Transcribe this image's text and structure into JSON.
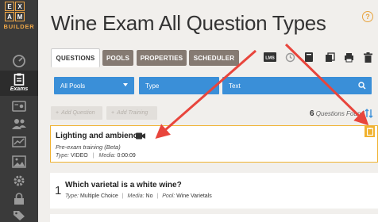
{
  "logo": {
    "letters": [
      "E",
      "X",
      "",
      "A",
      "M",
      ""
    ],
    "text": "BUILDER"
  },
  "sidebar": {
    "active_label": "Exams"
  },
  "page": {
    "title": "Wine Exam All Question Types"
  },
  "tabs": [
    {
      "label": "QUESTIONS"
    },
    {
      "label": "POOLS"
    },
    {
      "label": "PROPERTIES"
    },
    {
      "label": "SCHEDULER"
    }
  ],
  "toolbar": {
    "lms_label": "LMS"
  },
  "filters": {
    "pools": "All Pools",
    "type": "Type",
    "text": "Text"
  },
  "actions": {
    "add_question": "Add Question",
    "add_training": "Add Training"
  },
  "questions_found": {
    "count": "6",
    "label": "Questions Found"
  },
  "training_item": {
    "title": "Lighting and ambience",
    "subtitle": "Pre-exam training (Beta)",
    "type_label": "Type:",
    "type_value": "VIDEO",
    "media_label": "Media:",
    "media_value": "0:00:09"
  },
  "question_1": {
    "number": "1",
    "title": "Which varietal is a white wine?",
    "type_label": "Type:",
    "type_value": "Multiple Choice",
    "media_label": "Media:",
    "media_value": "No",
    "pool_label": "Pool:",
    "pool_value": "Wine Varietals"
  },
  "colors": {
    "sidebar": "#3a3a3a",
    "accent_orange": "#f0b230",
    "filter_blue": "#3a8fd8",
    "tab_brown": "#857a72",
    "arrow_red": "#e8453c"
  }
}
